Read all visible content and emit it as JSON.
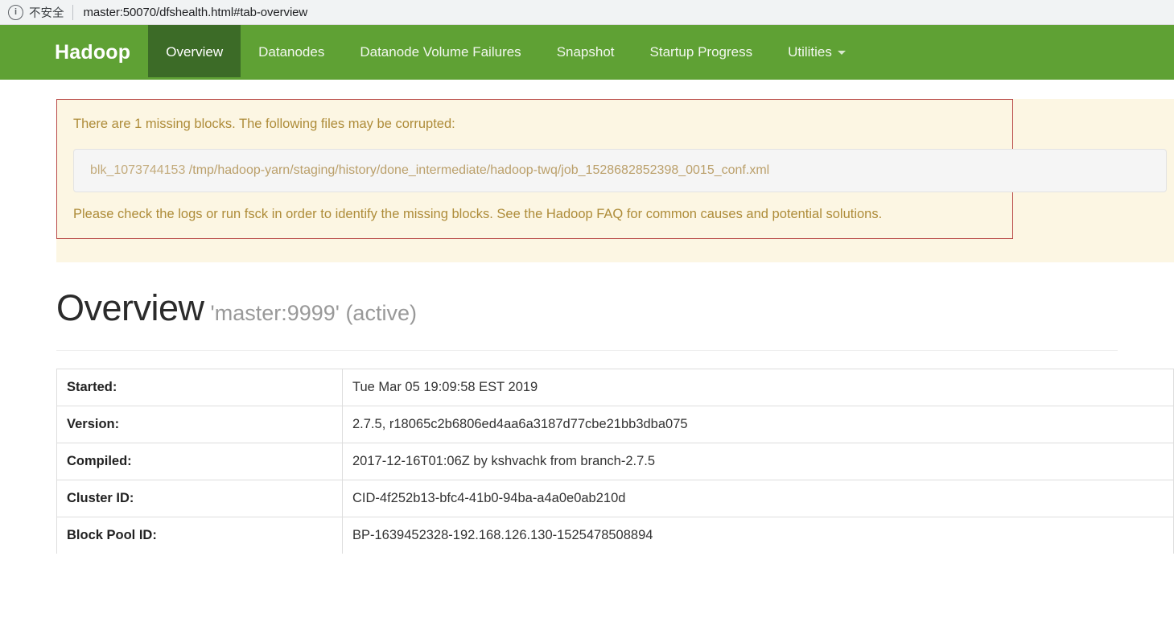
{
  "browser": {
    "security_icon": "info-circle-icon",
    "security_label": "不安全",
    "url": "master:50070/dfshealth.html#tab-overview"
  },
  "navbar": {
    "brand": "Hadoop",
    "items": [
      {
        "label": "Overview",
        "active": true
      },
      {
        "label": "Datanodes",
        "active": false
      },
      {
        "label": "Datanode Volume Failures",
        "active": false
      },
      {
        "label": "Snapshot",
        "active": false
      },
      {
        "label": "Startup Progress",
        "active": false
      },
      {
        "label": "Utilities",
        "active": false,
        "has_caret": true
      }
    ],
    "bg_color": "#5fa134",
    "active_color": "#3c6b27"
  },
  "alert": {
    "title": "There are 1 missing blocks. The following files may be corrupted:",
    "corrupt_files": [
      {
        "block_id": "blk_1073744153",
        "path": "/tmp/hadoop-yarn/staging/history/done_intermediate/hadoop-twq/job_1528682852398_0015_conf.xml"
      }
    ],
    "footer": "Please check the logs or run fsck in order to identify the missing blocks. See the Hadoop FAQ for common causes and potential solutions.",
    "border_color": "#b94a48",
    "bg_color": "#fcf6e3",
    "text_color": "#ae8c39"
  },
  "overview": {
    "title": "Overview",
    "subtitle": "'master:9999' (active)"
  },
  "summary": {
    "rows": [
      {
        "label": "Started:",
        "value": "Tue Mar 05 19:09:58 EST 2019"
      },
      {
        "label": "Version:",
        "value": "2.7.5, r18065c2b6806ed4aa6a3187d77cbe21bb3dba075"
      },
      {
        "label": "Compiled:",
        "value": "2017-12-16T01:06Z by kshvachk from branch-2.7.5"
      },
      {
        "label": "Cluster ID:",
        "value": "CID-4f252b13-bfc4-41b0-94ba-a4a0e0ab210d"
      },
      {
        "label": "Block Pool ID:",
        "value": "BP-1639452328-192.168.126.130-1525478508894"
      }
    ]
  }
}
